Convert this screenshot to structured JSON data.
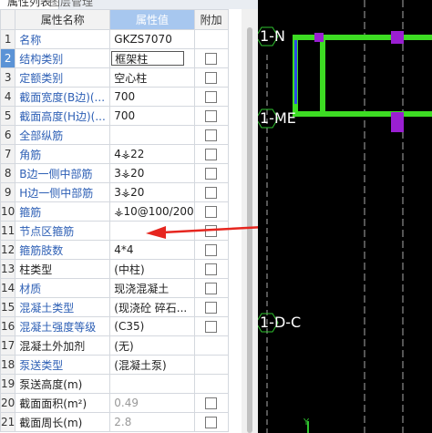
{
  "tabs": {
    "active": "属性列表",
    "inactive": "图层管理"
  },
  "header": {
    "name": "属性名称",
    "value": "属性值",
    "extra": "附加"
  },
  "rows": [
    {
      "num": "1",
      "name": "名称",
      "value": "GKZS7070",
      "name_style": "blue",
      "value_style": "dark",
      "checkbox": false
    },
    {
      "num": "2",
      "name": "结构类别",
      "value": "框架柱",
      "name_style": "blue",
      "value_style": "dark",
      "checkbox": true,
      "selected": true,
      "editing": true
    },
    {
      "num": "3",
      "name": "定额类别",
      "value": "空心柱",
      "name_style": "blue",
      "value_style": "dark",
      "checkbox": true
    },
    {
      "num": "4",
      "name": "截面宽度(B边)(...",
      "value": "700",
      "name_style": "blue",
      "value_style": "dark",
      "checkbox": true
    },
    {
      "num": "5",
      "name": "截面高度(H边)(...",
      "value": "700",
      "name_style": "blue",
      "value_style": "dark",
      "checkbox": true
    },
    {
      "num": "6",
      "name": "全部纵筋",
      "value": "",
      "name_style": "blue",
      "value_style": "dark",
      "checkbox": true
    },
    {
      "num": "7",
      "name": "角筋",
      "value": "4⚶22",
      "name_style": "blue",
      "value_style": "dark",
      "checkbox": true
    },
    {
      "num": "8",
      "name": "B边一侧中部筋",
      "value": "3⚶20",
      "name_style": "blue",
      "value_style": "dark",
      "checkbox": true
    },
    {
      "num": "9",
      "name": "H边一侧中部筋",
      "value": "3⚶20",
      "name_style": "blue",
      "value_style": "dark",
      "checkbox": true
    },
    {
      "num": "10",
      "name": "箍筋",
      "value": "⚶10@100/200",
      "name_style": "blue",
      "value_style": "dark",
      "checkbox": true
    },
    {
      "num": "11",
      "name": "节点区箍筋",
      "value": "",
      "name_style": "blue",
      "value_style": "dark",
      "checkbox": true
    },
    {
      "num": "12",
      "name": "箍筋肢数",
      "value": "4*4",
      "name_style": "blue",
      "value_style": "dark",
      "checkbox": true
    },
    {
      "num": "13",
      "name": "柱类型",
      "value": "(中柱)",
      "name_style": "dark",
      "value_style": "dark",
      "checkbox": true
    },
    {
      "num": "14",
      "name": "材质",
      "value": "现浇混凝土",
      "name_style": "blue",
      "value_style": "dark",
      "checkbox": true
    },
    {
      "num": "15",
      "name": "混凝土类型",
      "value": "(现浇砼 碎石...",
      "name_style": "blue",
      "value_style": "dark",
      "checkbox": true
    },
    {
      "num": "16",
      "name": "混凝土强度等级",
      "value": "(C35)",
      "name_style": "blue",
      "value_style": "dark",
      "checkbox": true
    },
    {
      "num": "17",
      "name": "混凝土外加剂",
      "value": "(无)",
      "name_style": "dark",
      "value_style": "dark",
      "checkbox": false
    },
    {
      "num": "18",
      "name": "泵送类型",
      "value": "(混凝土泵)",
      "name_style": "blue",
      "value_style": "dark",
      "checkbox": false
    },
    {
      "num": "19",
      "name": "泵送高度(m)",
      "value": "",
      "name_style": "dark",
      "value_style": "dark",
      "checkbox": false
    },
    {
      "num": "20",
      "name": "截面面积(m²)",
      "value": "0.49",
      "name_style": "dark",
      "value_style": "gray",
      "checkbox": true
    },
    {
      "num": "21",
      "name": "截面周长(m)",
      "value": "2.8",
      "name_style": "dark",
      "value_style": "gray",
      "checkbox": true
    }
  ],
  "canvas": {
    "axis_labels": [
      "1-N",
      "1-ME",
      "1-D-C"
    ],
    "axis_icon": "y-axis-icon"
  },
  "colors": {
    "accent": "#5b93d6",
    "header_highlight": "#a7c7ef",
    "beam": "#3ddc23",
    "column": "#9a1fd2",
    "arrow": "#e6261f",
    "axis_circle": "#2fc32f"
  }
}
